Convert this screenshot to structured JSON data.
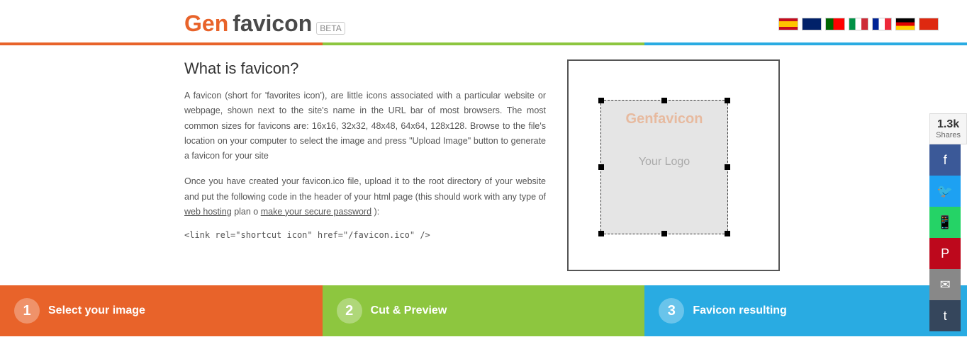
{
  "header": {
    "logo_gen": "Gen",
    "logo_favicon": "favicon",
    "logo_beta": "BETA"
  },
  "nav": {
    "languages": [
      "ES",
      "GB",
      "PT",
      "IT",
      "FR",
      "DE",
      "CN"
    ]
  },
  "content": {
    "section_title": "What is favicon?",
    "description_1": "A favicon (short for 'favorites icon'), are little icons associated with a particular website or webpage, shown next to the site's name in the URL bar of most browsers. The most common sizes for favicons are: 16x16, 32x32, 48x48, 64x64, 128x128. Browse to the file's location on your computer to select the image and press \"Upload Image\" button to generate a favicon for your site",
    "description_2": "Once you have created your favicon.ico file, upload it to the root directory of your website and put the following code in the header of your html page (this should work with any type of",
    "link_web_hosting": "web hosting",
    "link_plan_o": "plan o",
    "link_password": "make your secure password",
    "description_suffix": "):",
    "code_snippet": "<link rel=\"shortcut icon\" href=\"/favicon.ico\" />"
  },
  "preview": {
    "watermark_gen": "Genfavicon",
    "watermark_logo": "Your Logo"
  },
  "steps": [
    {
      "number": "1",
      "label": "Select your image"
    },
    {
      "number": "2",
      "label": "Cut & Preview"
    },
    {
      "number": "3",
      "label": "Favicon resulting"
    }
  ],
  "social": {
    "share_count": "1.3k",
    "share_label": "Shares"
  }
}
